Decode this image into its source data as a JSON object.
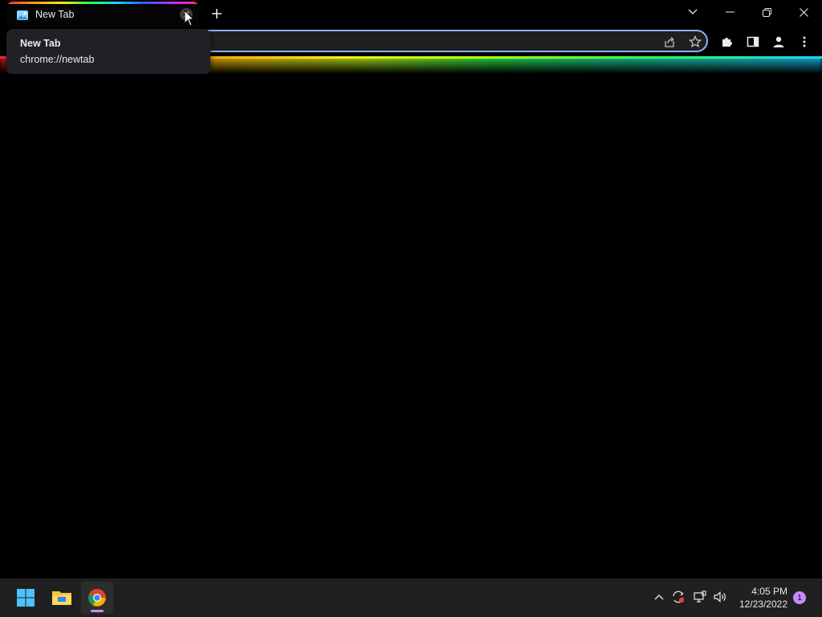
{
  "browser": {
    "tab": {
      "title": "New Tab"
    },
    "hovercard": {
      "title": "New Tab",
      "url": "chrome://newtab"
    },
    "icons": [
      "image-favicon-icon",
      "close-icon",
      "new-tab-plus-icon",
      "tab-search-chevron-icon",
      "minimize-icon",
      "restore-icon",
      "close-window-icon",
      "share-icon",
      "star-icon",
      "extensions-icon",
      "side-panel-icon",
      "profile-icon",
      "more-menu-icon"
    ]
  },
  "taskbar": {
    "apps": [
      "windows-start-icon",
      "file-explorer-icon",
      "chrome-icon"
    ],
    "clock": {
      "time": "4:05 PM",
      "date": "12/23/2022"
    },
    "notification_count": "1"
  },
  "colors": {
    "accent": "#8ab4f8",
    "taskbar": "#202020",
    "badge": "#c58af9"
  }
}
